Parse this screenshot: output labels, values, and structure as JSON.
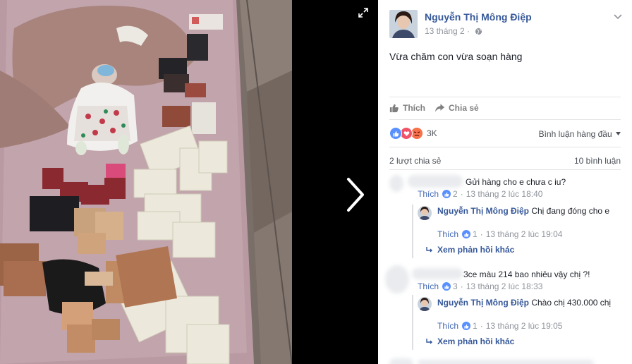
{
  "post": {
    "author": "Nguyễn Thị Mông Điệp",
    "date": "13 tháng 2",
    "caption": "Vừa chăm con vừa soạn hàng",
    "like_label": "Thích",
    "share_label": "Chia sẻ",
    "reaction_count": "3K",
    "sort_label": "Bình luận hàng đầu",
    "shares": "2 lượt chia sẻ",
    "comments_total": "10 bình luận"
  },
  "comments": [
    {
      "author": "",
      "text": "Gửi hàng cho e chưa c iu?",
      "like_label": "Thích",
      "likes": "2",
      "time": "13 tháng 2 lúc 18:40",
      "reply": {
        "author": "Nguyễn Thị Mông Điệp",
        "text": "Chị đang đóng cho e",
        "like_label": "Thích",
        "likes": "1",
        "time": "13 tháng 2 lúc 19:04"
      },
      "more_replies": "Xem phản hồi khác"
    },
    {
      "author": "",
      "text": "3ce màu 214 bao nhiêu vậy chị ?!",
      "like_label": "Thích",
      "likes": "3",
      "time": "13 tháng 2 lúc 18:33",
      "reply": {
        "author": "Nguyễn Thị Mông Điệp",
        "text": "Chào chị 430.000 chị",
        "like_label": "Thích",
        "likes": "1",
        "time": "13 tháng 2 lúc 19:05"
      },
      "more_replies": "Xem phản hồi khác"
    }
  ],
  "icons": {
    "expand": "expand-icon",
    "next": "chevron-right-icon",
    "globe": "globe-icon",
    "like": "thumbs-up-icon",
    "share": "share-arrow-icon",
    "love": "heart-icon",
    "angry": "angry-face-icon",
    "reply": "reply-arrow-icon"
  },
  "colors": {
    "link": "#365899",
    "like_blue": "#5890ff",
    "love_red": "#f25268",
    "angry_orange": "#f7714b",
    "muted": "#90949c"
  }
}
